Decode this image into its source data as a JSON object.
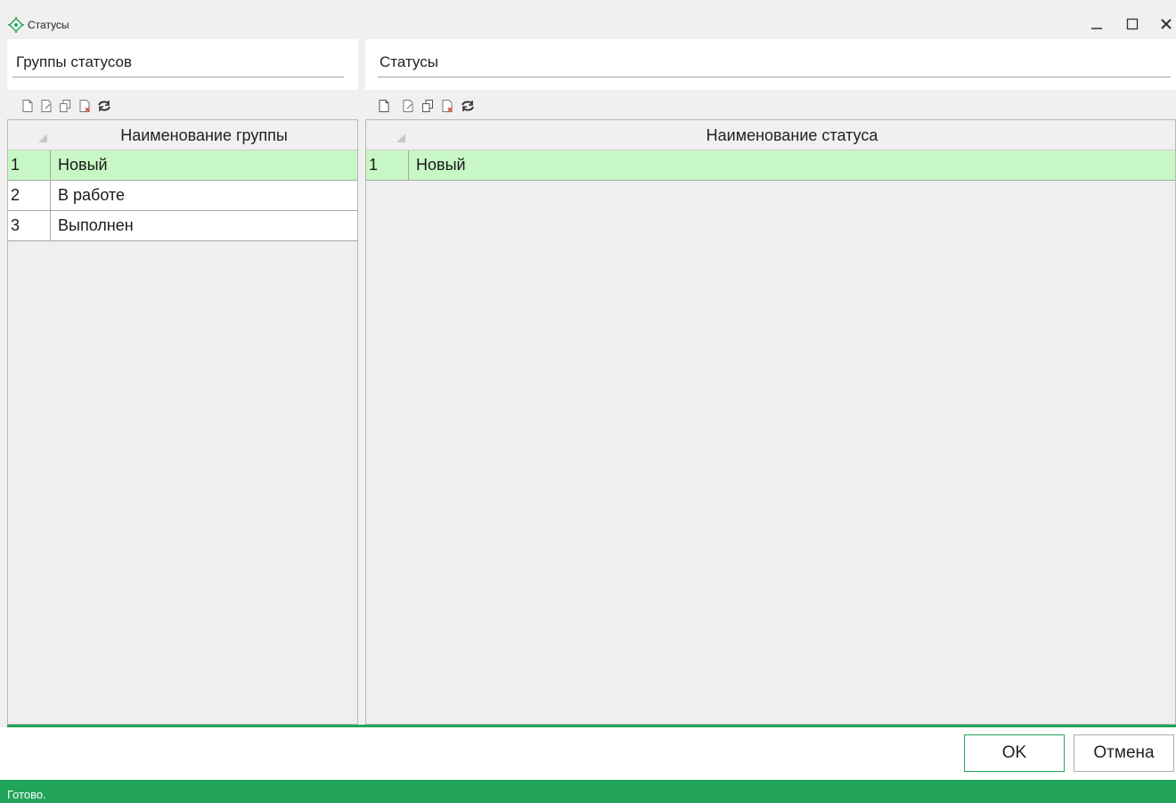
{
  "window": {
    "title": "Статусы",
    "icon": "status-crosshair-icon",
    "controls": {
      "minimize": "minimize-icon",
      "maximize": "maximize-icon",
      "close": "close-icon"
    }
  },
  "left_pane": {
    "header": "Группы статусов",
    "toolbar": [
      "new-doc-icon",
      "edit-doc-icon",
      "copy-doc-icon",
      "delete-doc-icon",
      "refresh-icon"
    ],
    "column_header": "Наименование группы",
    "rows": [
      {
        "num": "1",
        "name": "Новый",
        "selected": true
      },
      {
        "num": "2",
        "name": "В работе",
        "selected": false
      },
      {
        "num": "3",
        "name": "Выполнен",
        "selected": false
      }
    ]
  },
  "right_pane": {
    "header": "Статусы",
    "toolbar": [
      "new-doc-icon",
      "edit-doc-icon",
      "copy-doc-icon",
      "delete-doc-icon",
      "refresh-icon"
    ],
    "column_header": "Наименование статуса",
    "rows": [
      {
        "num": "1",
        "name": "Новый",
        "selected": true
      }
    ]
  },
  "buttons": {
    "ok": "OK",
    "cancel": "Отмена"
  },
  "status": {
    "text": "Готово."
  },
  "colors": {
    "accent": "#22a55a",
    "selected_row": "#c7f7c4",
    "background": "#f0f0f0"
  }
}
